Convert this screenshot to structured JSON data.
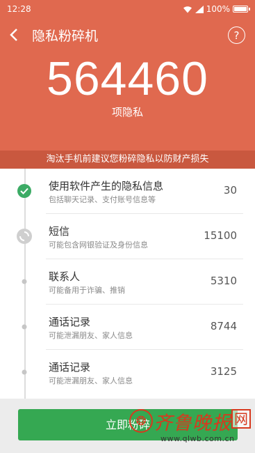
{
  "status": {
    "time": "12:28",
    "battery": "100%",
    "battery_level": 1.0
  },
  "header": {
    "title": "隐私粉碎机",
    "help_label": "?"
  },
  "summary": {
    "count": "564460",
    "unit": "项隐私"
  },
  "banner": "淘汰手机前建议您粉碎隐私以防财产损失",
  "items": [
    {
      "name": "使用软件产生的隐私信息",
      "desc": "包括聊天记录、支付账号信息等",
      "count": "30",
      "state": "done"
    },
    {
      "name": "短信",
      "desc": "可能包含网银验证及身份信息",
      "count": "15100",
      "state": "scanning"
    },
    {
      "name": "联系人",
      "desc": "可能备用于诈骗、推销",
      "count": "5310",
      "state": "pending"
    },
    {
      "name": "通话记录",
      "desc": "可能泄漏朋友、家人信息",
      "count": "8744",
      "state": "pending"
    },
    {
      "name": "通话记录",
      "desc": "可能泄漏朋友、家人信息",
      "count": "3125",
      "state": "pending"
    }
  ],
  "action": {
    "label": "立即粉碎"
  },
  "watermark": {
    "brand": "齐鲁晚报",
    "box": "网",
    "url": "www.qlwb.com.cn"
  },
  "colors": {
    "header": "#e0694f",
    "banner": "#c9583f",
    "accent_green": "#35a852",
    "check_green": "#3cab65"
  }
}
